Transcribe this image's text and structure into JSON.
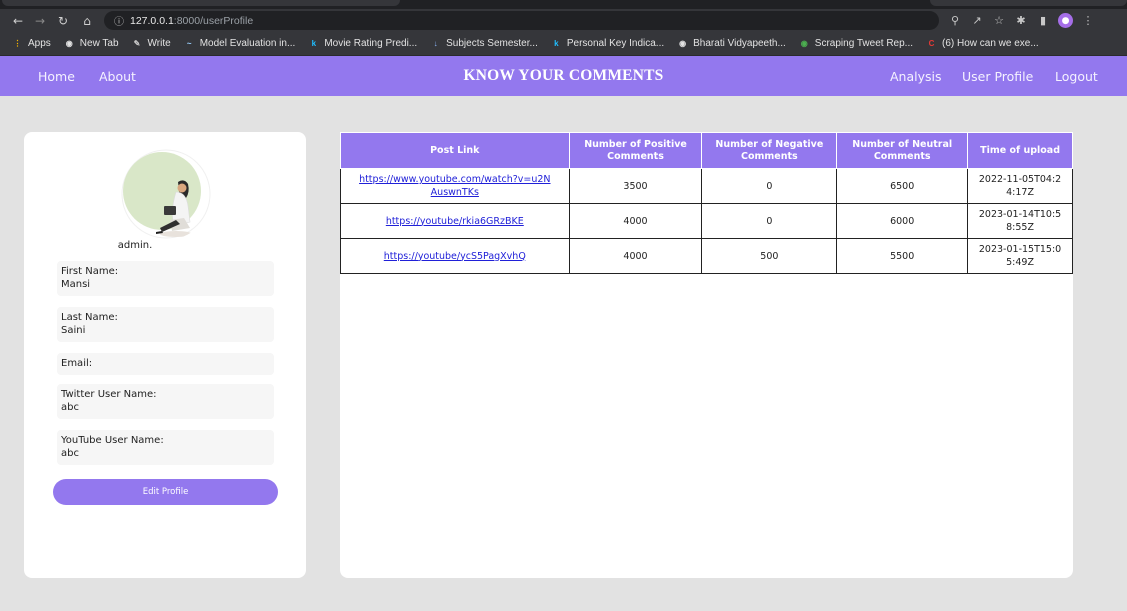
{
  "browser": {
    "url_host": "127.0.0.1",
    "url_path": ":8000/userProfile",
    "bookmarks": [
      {
        "label": "Apps",
        "icon": "apps-grid-icon",
        "color": "#f4b400"
      },
      {
        "label": "New Tab",
        "icon": "globe-icon",
        "color": "#e3e3e3"
      },
      {
        "label": "Write",
        "icon": "write-icon",
        "color": "#c8c8c8"
      },
      {
        "label": "Model Evaluation in...",
        "icon": "model-icon",
        "color": "#9ad1ff"
      },
      {
        "label": "Movie Rating Predi...",
        "icon": "k-icon",
        "color": "#20beff"
      },
      {
        "label": "Subjects Semester...",
        "icon": "download-icon",
        "color": "#8ab4f8"
      },
      {
        "label": "Personal Key Indica...",
        "icon": "k-icon",
        "color": "#20beff"
      },
      {
        "label": "Bharati Vidyapeeth...",
        "icon": "globe-icon",
        "color": "#e3e3e3"
      },
      {
        "label": "Scraping Tweet Rep...",
        "icon": "github-icon",
        "color": "#4caf50"
      },
      {
        "label": "(6) How can we exe...",
        "icon": "quora-icon",
        "color": "#e53935"
      }
    ]
  },
  "navbar": {
    "home": "Home",
    "about": "About",
    "brand": "KNOW YOUR COMMENTS",
    "analysis": "Analysis",
    "user_profile": "User Profile",
    "logout": "Logout"
  },
  "profile": {
    "username": "admin.",
    "fields": [
      {
        "label": "First Name:",
        "value": "Mansi"
      },
      {
        "label": "Last Name:",
        "value": "Saini"
      },
      {
        "label": "Email:",
        "value": ""
      },
      {
        "label": "Twitter User Name:",
        "value": "abc"
      },
      {
        "label": "YouTube User Name:",
        "value": "abc"
      }
    ],
    "edit_button": "Edit Profile"
  },
  "table": {
    "headers": [
      "Post Link",
      "Number of Positive Comments",
      "Number of Negative Comments",
      "Number of Neutral Comments",
      "Time of upload"
    ],
    "rows": [
      {
        "link": "https://www.youtube.com/watch?v=u2NAuswnTKs",
        "positive": "3500",
        "negative": "0",
        "neutral": "6500",
        "time": "2022-11-05T04:24:17Z"
      },
      {
        "link": "https://youtube/rkia6GRzBKE",
        "positive": "4000",
        "negative": "0",
        "neutral": "6000",
        "time": "2023-01-14T10:58:55Z"
      },
      {
        "link": "https://youtube/ycS5PagXvhQ",
        "positive": "4000",
        "negative": "500",
        "neutral": "5500",
        "time": "2023-01-15T15:05:49Z"
      }
    ]
  },
  "colors": {
    "accent": "#9378ee",
    "page_bg": "#e2e2e2",
    "link": "#2020d8"
  }
}
